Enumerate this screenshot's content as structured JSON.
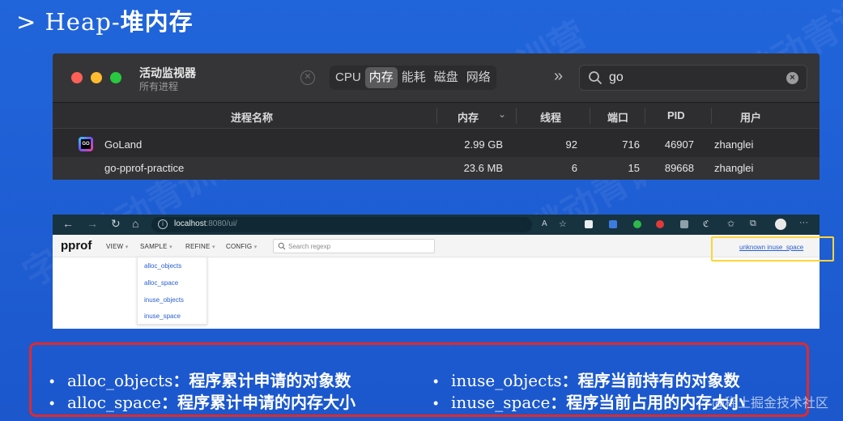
{
  "slide": {
    "title_prefix": "> Heap-",
    "title_cn": "堆内存",
    "watermark_text": "字节跳动青训营",
    "footer_watermark": "@稀土掘金技术社区"
  },
  "activity_monitor": {
    "app_title": "活动监视器",
    "subtitle": "所有进程",
    "tabs": [
      {
        "label": "CPU",
        "active": false
      },
      {
        "label": "内存",
        "active": true
      },
      {
        "label": "能耗",
        "active": false
      },
      {
        "label": "磁盘",
        "active": false
      },
      {
        "label": "网络",
        "active": false
      }
    ],
    "search_query": "go",
    "columns": [
      "进程名称",
      "内存",
      "线程",
      "端口",
      "PID",
      "用户"
    ],
    "rows": [
      {
        "name": "GoLand",
        "icon": "goland-icon",
        "memory": "2.99 GB",
        "threads": "92",
        "ports": "716",
        "pid": "46907",
        "user": "zhanglei"
      },
      {
        "name": "go-pprof-practice",
        "icon": "",
        "memory": "23.6 MB",
        "threads": "6",
        "ports": "15",
        "pid": "89668",
        "user": "zhanglei"
      }
    ]
  },
  "browser": {
    "url_host": "localhost",
    "url_rest": ":8080/ui/",
    "pprof": {
      "logo": "pprof",
      "menus": [
        "VIEW",
        "SAMPLE",
        "REFINE",
        "CONFIG"
      ],
      "search_placeholder": "Search regexp",
      "sample_link": "unknown inuse_space",
      "sample_options": [
        "alloc_objects",
        "alloc_space",
        "inuse_objects",
        "inuse_space"
      ]
    }
  },
  "bullets": [
    {
      "term": "alloc_objects",
      "desc": "：程序累计申请的对象数"
    },
    {
      "term": "alloc_space",
      "desc": "：程序累计申请的内存大小"
    },
    {
      "term": "inuse_objects",
      "desc": "：程序当前持有的对象数"
    },
    {
      "term": "inuse_space",
      "desc": "：程序当前占用的内存大小"
    }
  ],
  "colors": {
    "slide_bg": "#2165db",
    "highlight_red": "#e02a2a",
    "highlight_yellow": "#ffd43a",
    "link_blue": "#2a5fd0"
  }
}
